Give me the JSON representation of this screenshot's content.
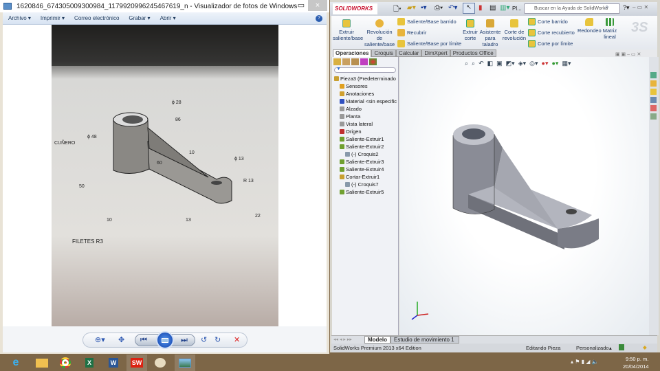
{
  "photo_viewer": {
    "title": "1620846_674305009300984_1179920996245467619_n - Visualizador de fotos de Windows",
    "menu": [
      "Archivo ▾",
      "Imprimir ▾",
      "Correo electrónico",
      "Grabar ▾",
      "Abrir ▾"
    ],
    "photo_labels": {
      "d48": "ϕ 48",
      "d28": "ϕ 28",
      "l86": "86",
      "keyway": "CUÑERO",
      "t10": "10",
      "a60": "60",
      "d13": "ϕ 13",
      "r13": "R 13",
      "h50": "50",
      "b10": "10",
      "w13": "13",
      "h22": "22",
      "fillets": "FILETES R3"
    }
  },
  "solidworks": {
    "brand": "SOLIDWORKS",
    "search_placeholder": "Buscar en la Ayuda de SolidWorks",
    "ribbon": {
      "extrude": "Extruir saliente/base",
      "revolve": "Revolución de saliente/base",
      "sweep": "Saliente/Base barrido",
      "loft": "Recubrir",
      "boundary": "Saliente/Base por límite",
      "cut_extrude": "Extruir corte",
      "hole": "Asistente para taladro",
      "cut_revolve": "Corte de revolución",
      "cut_sweep": "Corte barrido",
      "cut_loft": "Corte recubierto",
      "cut_boundary": "Corte por límite",
      "fillet": "Redondeo",
      "pattern": "Matriz lineal"
    },
    "tabs": [
      "Operaciones",
      "Croquis",
      "Calcular",
      "DimXpert",
      "Productos Office"
    ],
    "active_tab": "Operaciones",
    "tree": [
      {
        "label": "Pieza3  (Predeterminado",
        "color": "#c8a030",
        "level": 0
      },
      {
        "label": "Sensores",
        "color": "#e0a020",
        "level": 1
      },
      {
        "label": "Anotaciones",
        "color": "#d0a030",
        "level": 1
      },
      {
        "label": "Material <sin especific",
        "color": "#3050c0",
        "level": 1
      },
      {
        "label": "Alzado",
        "color": "#999999",
        "level": 1
      },
      {
        "label": "Planta",
        "color": "#999999",
        "level": 1
      },
      {
        "label": "Vista lateral",
        "color": "#999999",
        "level": 1
      },
      {
        "label": "Origen",
        "color": "#c03030",
        "level": 1
      },
      {
        "label": "Saliente-Extruir1",
        "color": "#70a030",
        "level": 1
      },
      {
        "label": "Saliente-Extruir2",
        "color": "#70a030",
        "level": 1
      },
      {
        "label": "(-) Croquis2",
        "color": "#8899aa",
        "level": 2
      },
      {
        "label": "Saliente-Extruir3",
        "color": "#70a030",
        "level": 1
      },
      {
        "label": "Saliente-Extruir4",
        "color": "#70a030",
        "level": 1
      },
      {
        "label": "Cortar-Extruir1",
        "color": "#c8a030",
        "level": 1
      },
      {
        "label": "(-) Croquis7",
        "color": "#8899aa",
        "level": 2
      },
      {
        "label": "Saliente-Extruir5",
        "color": "#70a030",
        "level": 1
      }
    ],
    "bottom_tabs": [
      "Modelo",
      "Estudio de movimiento 1"
    ],
    "status": {
      "edition": "SolidWorks Premium 2013 x64 Edition",
      "mode": "Editando Pieza",
      "units": "Personalizado"
    }
  },
  "taskbar": {
    "apps": [
      "Internet Explorer",
      "Explorador de archivos",
      "Chrome",
      "Excel",
      "Word",
      "SolidWorks",
      "Paint",
      "Visualizador de fotos"
    ],
    "time": "9:50 p. m.",
    "date": "20/04/2014"
  }
}
